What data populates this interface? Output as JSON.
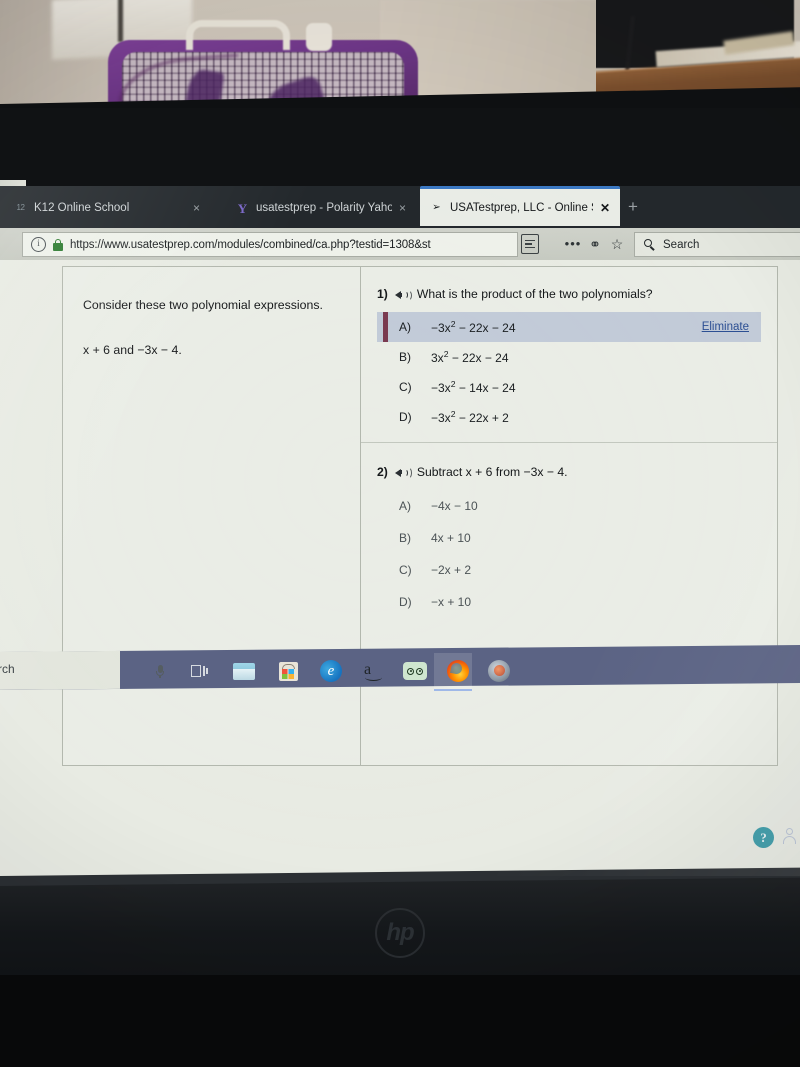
{
  "browser": {
    "tabs": [
      {
        "title": "K12 Online School",
        "favicon": "k12-favicon",
        "active": false,
        "close_label": "×"
      },
      {
        "title": "usatestprep - Polarity Yahoo",
        "favicon": "yahoo-favicon",
        "active": false,
        "close_label": "×"
      },
      {
        "title": "USATestprep, LLC - Online Statе",
        "favicon": "cursor-favicon",
        "active": true,
        "close_label": "✕"
      }
    ],
    "new_tab_label": "+",
    "address_bar": {
      "url": "https://www.usatestprep.com/modules/combined/ca.php?testid=1308&st",
      "info_icon": "ⓘ",
      "lock_icon": "lock-icon"
    },
    "toolbar": {
      "reader_view": "reader-view-icon",
      "page_actions": "•••",
      "pocket": "pocket-icon",
      "bookmark": "☆"
    },
    "search": {
      "placeholder": "Search",
      "value": "Search",
      "icon": "search-icon"
    }
  },
  "page": {
    "passage": {
      "intro": "Consider these two polynomial expressions.",
      "expression": "x + 6 and −3x − 4."
    },
    "questions": [
      {
        "number": "1)",
        "audio_icon": "speaker-icon",
        "text": "What is the product of the two polynomials?",
        "choices": [
          {
            "label": "A)",
            "pre": "−3x",
            "sup": "2",
            "post": " − 22x − 24",
            "selected": true,
            "eliminate_label": "Eliminate"
          },
          {
            "label": "B)",
            "pre": "3x",
            "sup": "2",
            "post": " − 22x − 24",
            "selected": false
          },
          {
            "label": "C)",
            "pre": "−3x",
            "sup": "2",
            "post": " − 14x − 24",
            "selected": false
          },
          {
            "label": "D)",
            "pre": "−3x",
            "sup": "2",
            "post": " − 22x + 2",
            "selected": false
          }
        ]
      },
      {
        "number": "2)",
        "audio_icon": "speaker-icon",
        "text": "Subtract x + 6 from −3x − 4.",
        "choices": [
          {
            "label": "A)",
            "pre": "−4x − 10",
            "sup": "",
            "post": "",
            "selected": false
          },
          {
            "label": "B)",
            "pre": "4x + 10",
            "sup": "",
            "post": "",
            "selected": false
          },
          {
            "label": "C)",
            "pre": "−2x + 2",
            "sup": "",
            "post": "",
            "selected": false
          },
          {
            "label": "D)",
            "pre": "−x + 10",
            "sup": "",
            "post": "",
            "selected": false
          }
        ]
      }
    ]
  },
  "taskbar": {
    "search_text": "rch",
    "items": [
      {
        "name": "microphone-icon"
      },
      {
        "name": "task-view-icon"
      },
      {
        "name": "file-explorer-icon"
      },
      {
        "name": "microsoft-store-icon"
      },
      {
        "name": "edge-icon",
        "glyph": "e"
      },
      {
        "name": "amazon-icon",
        "glyph": "a"
      },
      {
        "name": "tripadvisor-icon"
      },
      {
        "name": "firefox-icon"
      },
      {
        "name": "media-app-icon"
      }
    ],
    "tray": {
      "help_icon": "?",
      "account_icon": "person-icon"
    }
  },
  "device": {
    "brand_logo": "hp"
  },
  "colors": {
    "selected_choice_bg": "#c2cbd8",
    "selected_marker": "#7a3a50",
    "link_blue": "#2c4f93",
    "active_tab_accent": "#3b78c3",
    "taskbar_bg": "#5b6384"
  }
}
